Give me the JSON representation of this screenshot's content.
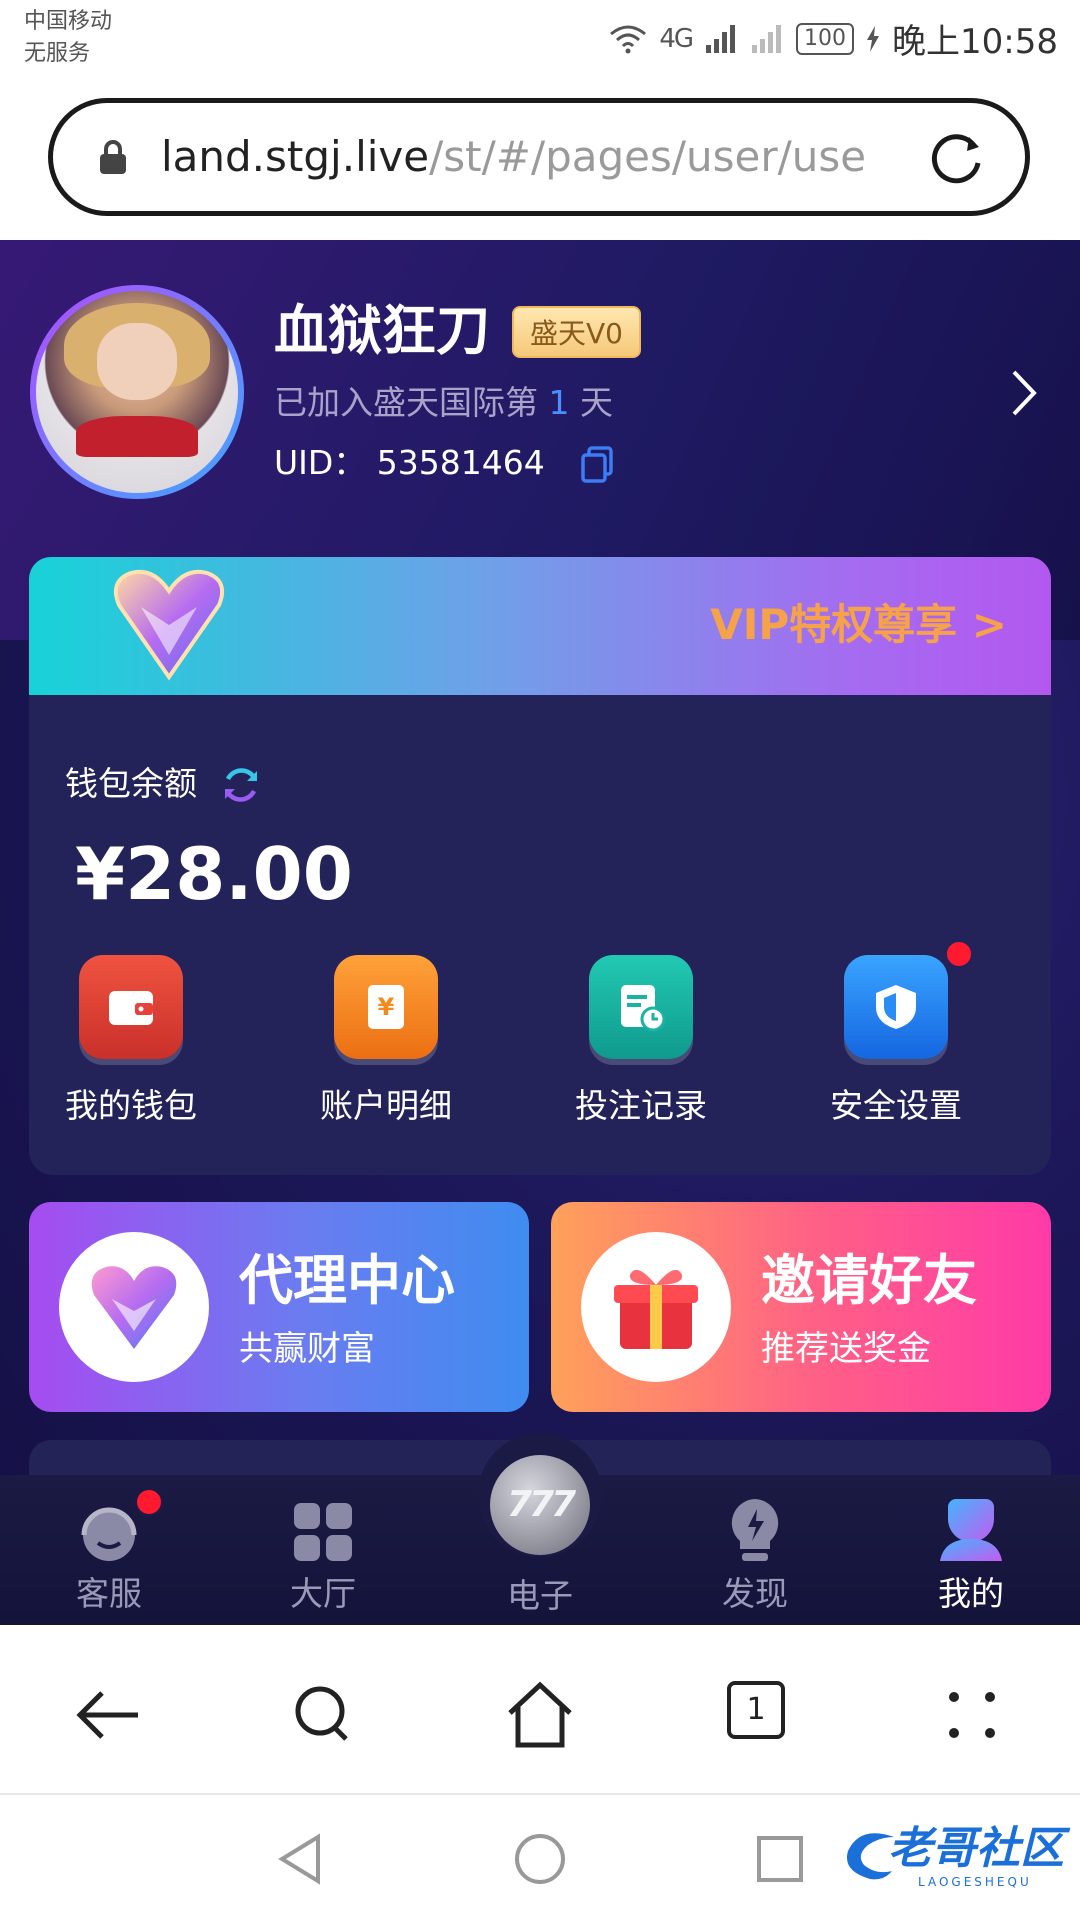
{
  "status_bar": {
    "carrier_line1": "中国移动",
    "carrier_line2": "无服务",
    "network": "4G",
    "battery": "100",
    "time": "晚上10:58"
  },
  "browser": {
    "url_host": "land.stgj.live",
    "url_path": "/st/#/pages/user/use",
    "tab_count": "1"
  },
  "profile": {
    "username": "血狱狂刀",
    "vip_level": "盛天V0",
    "joined_prefix": "已加入盛天国际第",
    "joined_days": "1",
    "joined_suffix": "天",
    "uid_label": "UID：",
    "uid_value": "53581464"
  },
  "vip_banner": {
    "text": "VIP特权尊享 >"
  },
  "wallet": {
    "balance_label": "钱包余额",
    "balance_value": "¥28.00",
    "actions": [
      {
        "label": "我的钱包",
        "icon": "wallet-icon",
        "color": "#e8413a"
      },
      {
        "label": "账户明细",
        "icon": "ledger-icon",
        "color": "#f38a1e"
      },
      {
        "label": "投注记录",
        "icon": "bet-record-icon",
        "color": "#18b3a3"
      },
      {
        "label": "安全设置",
        "icon": "shield-icon",
        "color": "#2a8cf5"
      }
    ]
  },
  "promos": {
    "agent": {
      "title": "代理中心",
      "subtitle": "共赢财富"
    },
    "invite": {
      "title": "邀请好友",
      "subtitle": "推荐送奖金"
    }
  },
  "tabs": [
    {
      "label": "客服",
      "icon": "headset-icon"
    },
    {
      "label": "大厅",
      "icon": "grid-icon"
    },
    {
      "label": "电子",
      "icon": "slot-777-icon",
      "chip": "777"
    },
    {
      "label": "发现",
      "icon": "lightbulb-icon"
    },
    {
      "label": "我的",
      "icon": "person-icon",
      "active": true
    }
  ],
  "watermark": {
    "main": "老哥社区",
    "sub": "LAOGESHEQU"
  }
}
